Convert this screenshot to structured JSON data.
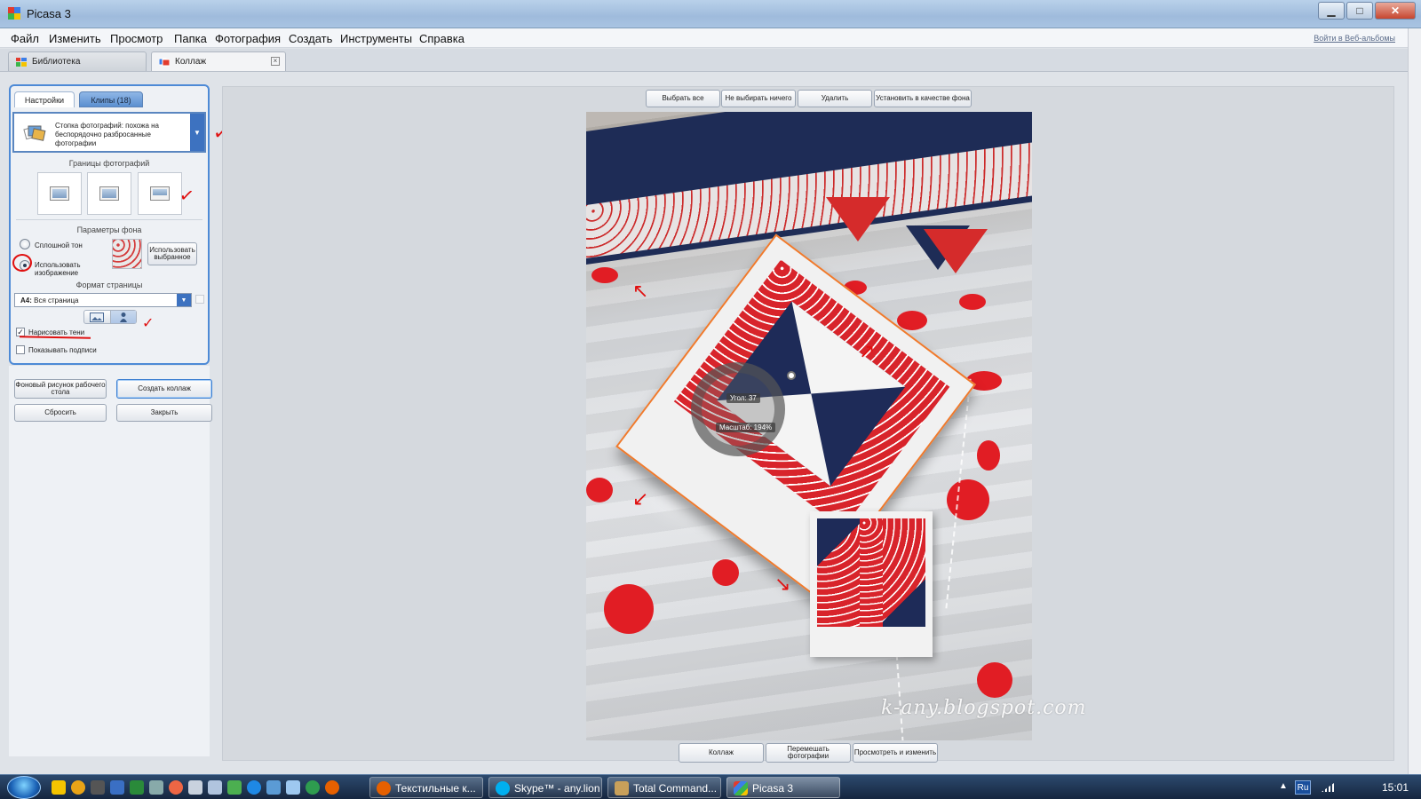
{
  "window": {
    "title": "Picasa 3",
    "controls": {
      "minimize": "▁",
      "maximize": "□",
      "close": "✕"
    }
  },
  "menu": {
    "items": [
      "Файл",
      "Изменить",
      "Просмотр",
      "Папка",
      "Фотография",
      "Создать",
      "Инструменты",
      "Справка"
    ],
    "login_link": "Войти в Веб-альбомы"
  },
  "doc_tabs": [
    {
      "label": "Библиотека",
      "icon": "library-icon"
    },
    {
      "label": "Коллаж",
      "icon": "collage-icon"
    }
  ],
  "panel": {
    "tabs": {
      "settings": "Настройки",
      "clips": "Клипы (18)"
    },
    "style_dropdown": "Стопка фотографий: похожа на беспорядочно разбросанные фотографии",
    "borders_title": "Границы фотографий",
    "background_title": "Параметры фона",
    "radio_solid": "Сплошной тон",
    "radio_image": "Использовать изображение",
    "use_selected_button": "Использовать выбранное",
    "page_format_title": "Формат страницы",
    "page_format_value_bold": "A4:",
    "page_format_value": "Вся страница",
    "draw_shadows": "Нарисовать тени",
    "draw_shadows_checked": true,
    "show_captions": "Показывать подписи",
    "show_captions_checked": false,
    "buttons": {
      "desktop_bg": "Фоновый рисунок рабочего стола",
      "create_collage": "Создать коллаж",
      "reset": "Сбросить",
      "close": "Закрыть"
    }
  },
  "canvas": {
    "top_buttons": {
      "select_all": "Выбрать все",
      "select_none": "Не выбирать ничего",
      "delete": "Удалить",
      "set_as_bg": "Установить в качестве фона"
    },
    "bottom_buttons": {
      "collage": "Коллаж",
      "shuffle": "Перемешать фотографии",
      "view_edit": "Просмотреть и изменить"
    },
    "rotate_widget": {
      "angle_label": "Угол: 37",
      "scale_label": "Масштаб: 194%"
    },
    "watermark": "k-any.blogspot.com"
  },
  "annotations": {
    "check_mark": "✓",
    "arrow_nw": "↖",
    "arrow_ne": "↗",
    "arrow_sw": "↙",
    "arrow_se": "↘"
  },
  "taskbar": {
    "items": [
      {
        "label": "Текстильные к...",
        "icon": "firefox-icon",
        "color": "#e66000"
      },
      {
        "label": "Skype™ - any.lion",
        "icon": "skype-icon",
        "color": "#00aff0"
      },
      {
        "label": "Total Command...",
        "icon": "total-commander-icon",
        "color": "#c8a05a"
      },
      {
        "label": "Picasa 3",
        "icon": "picasa-icon",
        "color": "#f5c400"
      }
    ],
    "tray": {
      "language": "Ru",
      "time": "15:01",
      "expand": "▲"
    }
  },
  "colors": {
    "accent_blue": "#3d72c0",
    "annotation_red": "#e01010",
    "selection_orange": "#f07a2c"
  }
}
